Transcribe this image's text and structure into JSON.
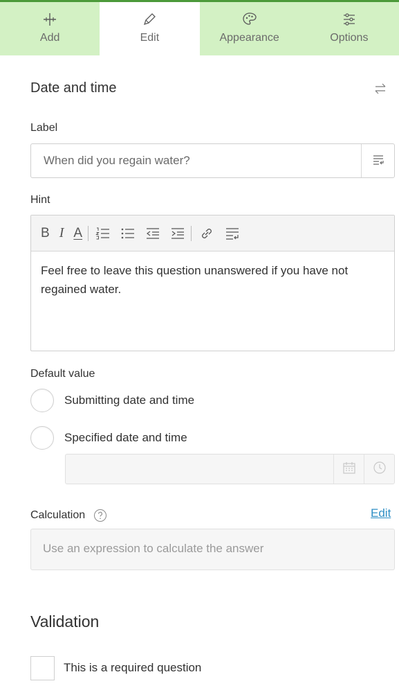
{
  "tabs": [
    {
      "label": "Add",
      "icon": "plus-icon",
      "active": false
    },
    {
      "label": "Edit",
      "icon": "pencil-icon",
      "active": true
    },
    {
      "label": "Appearance",
      "icon": "palette-icon",
      "active": false
    },
    {
      "label": "Options",
      "icon": "sliders-icon",
      "active": false
    }
  ],
  "colors": {
    "accent": "#4c9a3a",
    "tab_bg": "#d3f1c4",
    "link": "#2f8fc5"
  },
  "question": {
    "type_title": "Date and time",
    "label_heading": "Label",
    "label_value": "When did you regain water?",
    "hint_heading": "Hint",
    "hint_text": "Feel free to leave this question unanswered if you have not regained water.",
    "toolbar": {
      "bold": "B",
      "italic": "I",
      "underline": "A",
      "buttons": [
        "bold-icon",
        "italic-icon",
        "font-color-icon",
        "numbered-list-icon",
        "bulleted-list-icon",
        "outdent-icon",
        "indent-icon",
        "link-icon",
        "insert-text-icon"
      ]
    }
  },
  "default_value": {
    "heading": "Default value",
    "options": [
      {
        "label": "Submitting date and time",
        "selected": false
      },
      {
        "label": "Specified date and time",
        "selected": false
      }
    ],
    "date_time_value": ""
  },
  "calculation": {
    "heading": "Calculation",
    "edit_link": "Edit",
    "placeholder": "Use an expression to calculate the answer"
  },
  "validation": {
    "heading": "Validation",
    "required_label": "This is a required question",
    "required_checked": false
  }
}
